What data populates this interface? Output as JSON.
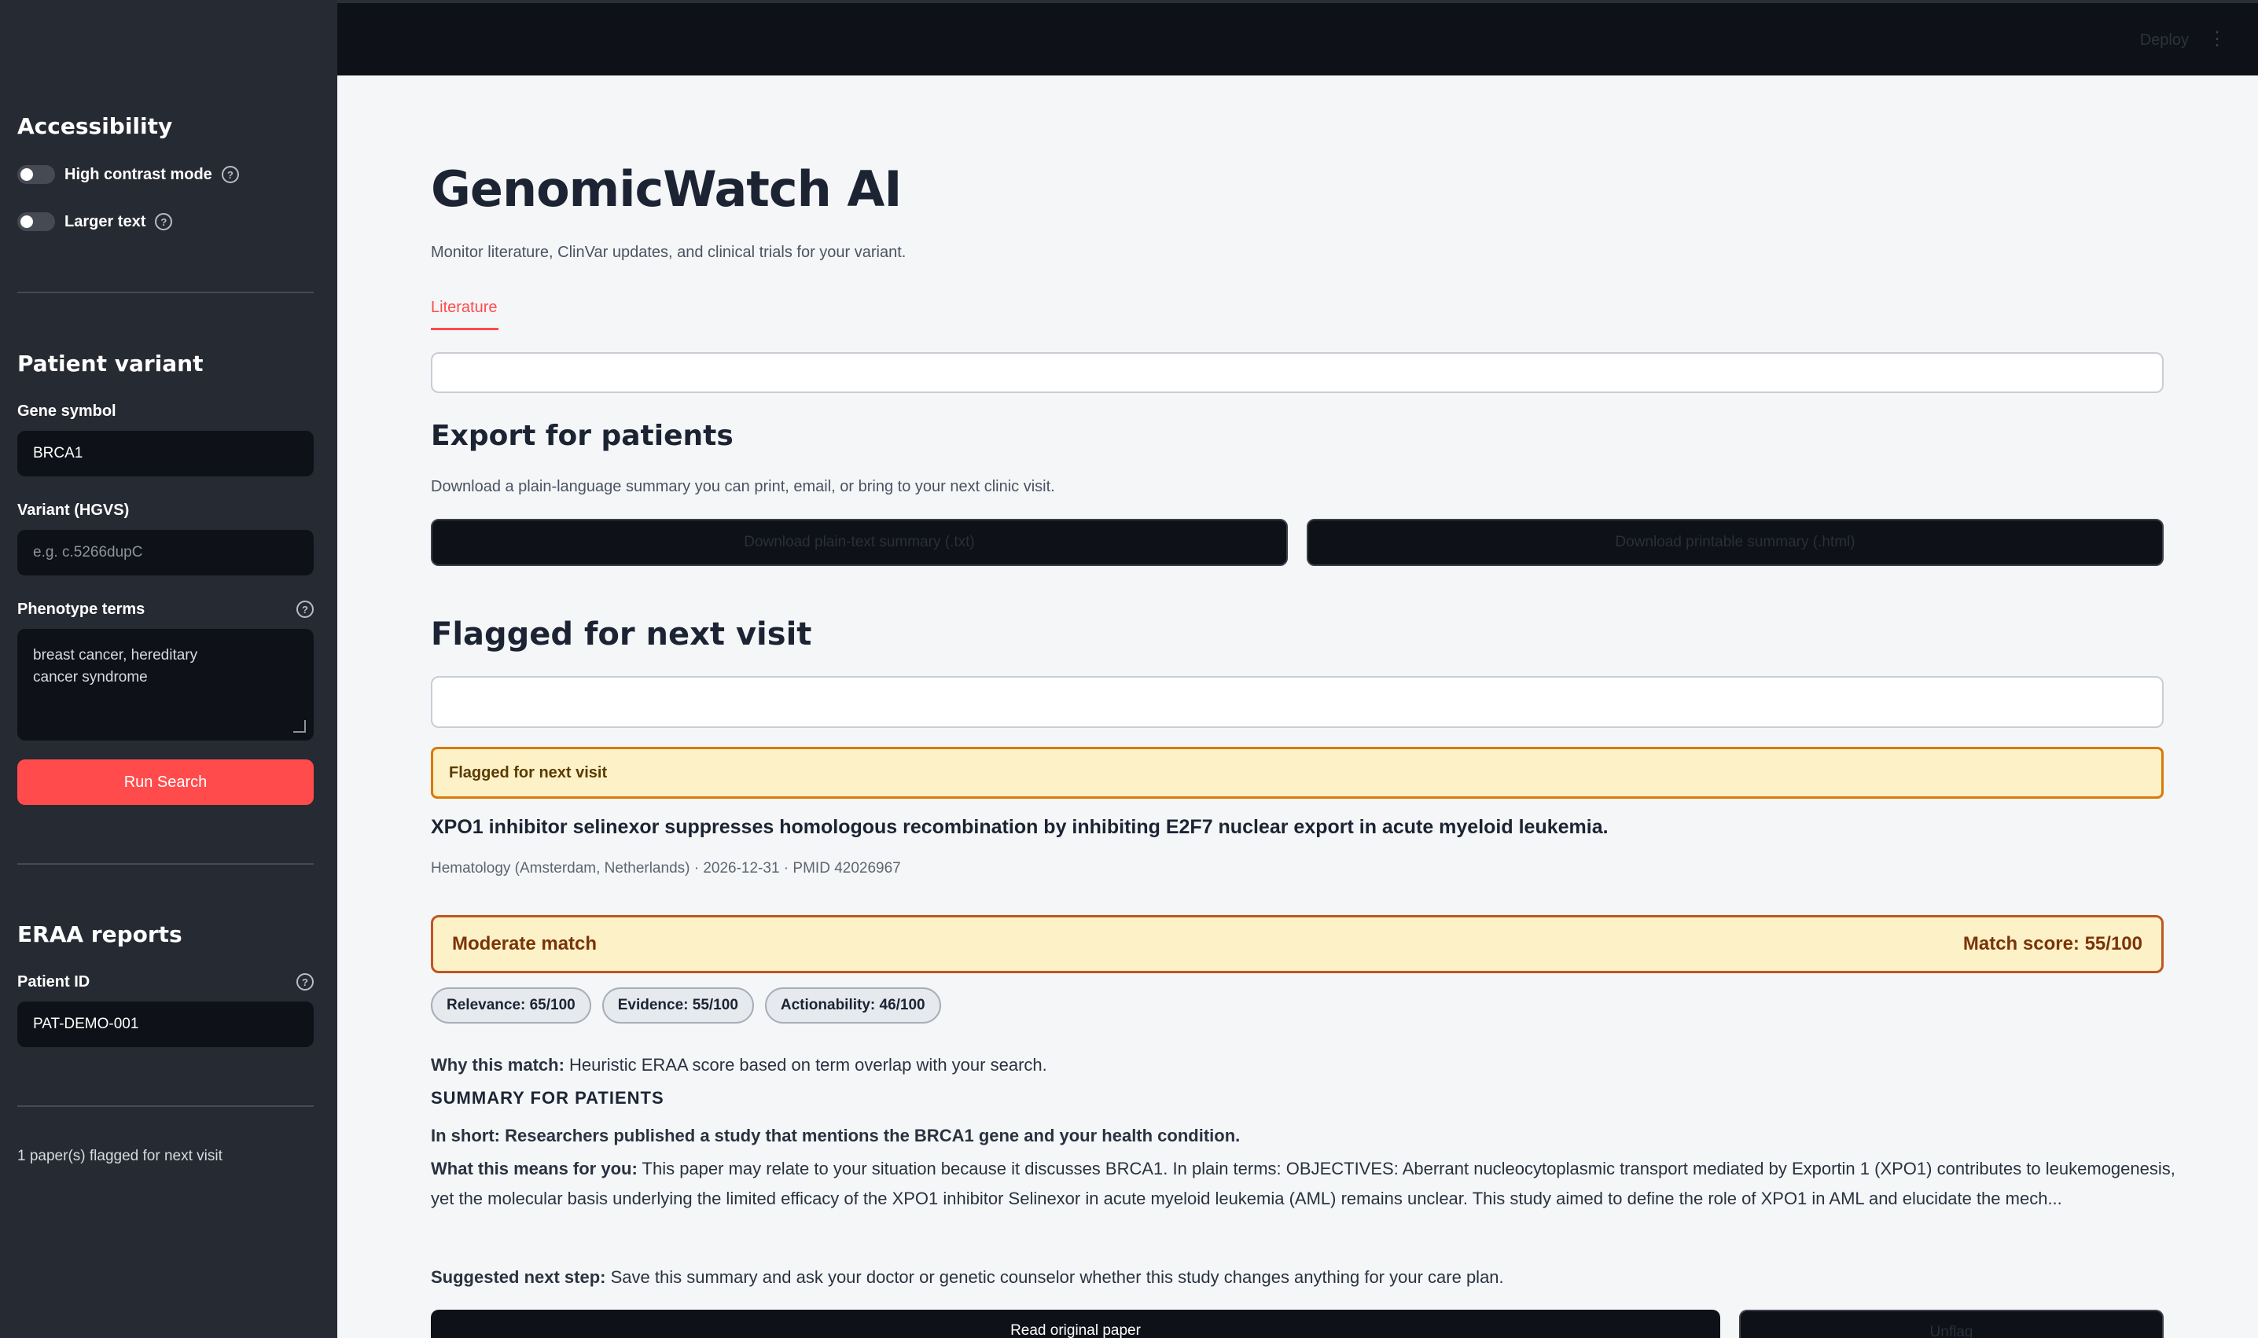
{
  "header": {
    "deploy_label": "Deploy",
    "menu_icon": "kebab-menu-icon"
  },
  "sidebar": {
    "accessibility": {
      "title": "Accessibility",
      "high_contrast_label": "High contrast mode",
      "larger_text_label": "Larger text",
      "high_contrast_on": false,
      "larger_text_on": false
    },
    "patient_variant": {
      "title": "Patient variant",
      "gene_label": "Gene symbol",
      "gene_value": "BRCA1",
      "variant_label": "Variant (HGVS)",
      "variant_placeholder": "e.g. c.5266dupC",
      "phenotype_label": "Phenotype terms",
      "phenotype_value": "breast cancer, hereditary cancer syndrome",
      "run_label": "Run Search"
    },
    "eraa": {
      "title": "ERAA reports",
      "patient_id_label": "Patient ID",
      "patient_id_value": "PAT-DEMO-001"
    },
    "flag_count_text": "1 paper(s) flagged for next visit"
  },
  "main": {
    "title": "GenomicWatch AI",
    "subtitle": "Monitor literature, ClinVar updates, and clinical trials for your variant.",
    "tabs": [
      {
        "label": "Literature",
        "active": true
      }
    ],
    "export": {
      "title": "Export for patients",
      "description": "Download a plain-language summary you can print, email, or bring to your next clinic visit.",
      "txt_button": "Download plain-text summary (.txt)",
      "html_button": "Download printable summary (.html)"
    },
    "flagged": {
      "title": "Flagged for next visit",
      "banner": "Flagged for next visit",
      "paper_title": "XPO1 inhibitor selinexor suppresses homologous recombination by inhibiting E2F7 nuclear export in acute myeloid leukemia.",
      "meta": "Hematology (Amsterdam, Netherlands) · 2026-12-31 · PMID 42026967",
      "match_label": "Moderate match",
      "match_score": "Match score: 55/100",
      "pills": [
        "Relevance: 65/100",
        "Evidence: 55/100",
        "Actionability: 46/100"
      ],
      "why_label": "Why this match:",
      "why_text": "Heuristic ERAA score based on term overlap with your search.",
      "summary_heading": "SUMMARY FOR PATIENTS",
      "in_short_label": "In short:",
      "in_short_text": "Researchers published a study that mentions the BRCA1 gene and your health condition.",
      "means_label": "What this means for you:",
      "means_text": "This paper may relate to your situation because it discusses BRCA1. In plain terms: OBJECTIVES: Aberrant nucleocytoplasmic transport mediated by Exportin 1 (XPO1) contributes to leukemogenesis, yet the molecular basis underlying the limited efficacy of the XPO1 inhibitor Selinexor in acute myeloid leukemia (AML) remains unclear. This study aimed to define the role of XPO1 in AML and elucidate the mech...",
      "next_step_label": "Suggested next step:",
      "next_step_text": "Save this summary and ask your doctor or genetic counselor whether this study changes anything for your care plan.",
      "read_button": "Read original paper",
      "unflag_button": "Unflag"
    }
  },
  "colors": {
    "accent": "#ff4b4b",
    "sidebar_bg": "#262a33",
    "main_bg": "#f4f6f8",
    "warning_bg": "#fdf1c8",
    "warning_border": "#c05621"
  }
}
